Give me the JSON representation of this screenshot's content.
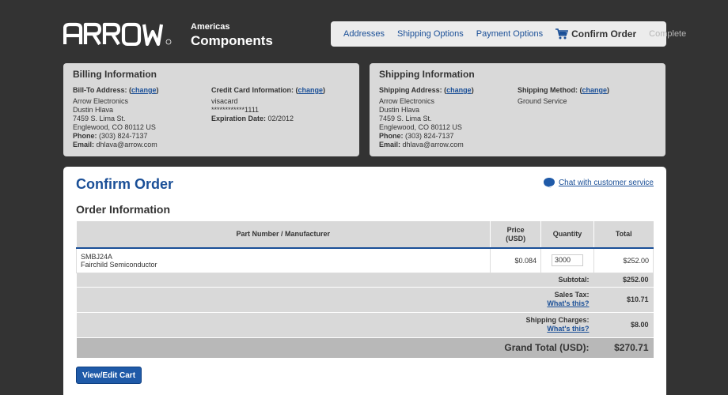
{
  "brand": {
    "logo_text": "ARROW",
    "region": "Americas",
    "name": "Components"
  },
  "steps": {
    "addresses": "Addresses",
    "shipping_options": "Shipping Options",
    "payment_options": "Payment Options",
    "confirm_order": "Confirm Order",
    "complete": "Complete"
  },
  "billing": {
    "title": "Billing Information",
    "bill_to_label": "Bill-To Address:",
    "change": "change",
    "address": [
      "Arrow Electronics",
      "Dustin Hlava",
      "7459 S. Lima St.",
      "Englewood, CO 80112 US"
    ],
    "phone_label": "Phone:",
    "phone": "(303) 824-7137",
    "email_label": "Email:",
    "email": "dhlava@arrow.com",
    "card_label": "Credit Card Information:",
    "card_type": "visacard",
    "card_number": "************1111",
    "exp_label": "Expiration Date:",
    "exp_value": "02/2012"
  },
  "shipping": {
    "title": "Shipping Information",
    "ship_to_label": "Shipping Address:",
    "change": "change",
    "address": [
      "Arrow Electronics",
      "Dustin Hlava",
      "7459 S. Lima St.",
      "Englewood, CO 80112 US"
    ],
    "phone_label": "Phone:",
    "phone": "(303) 824-7137",
    "email_label": "Email:",
    "email": "dhlava@arrow.com",
    "method_label": "Shipping Method:",
    "method": "Ground Service"
  },
  "main": {
    "title": "Confirm Order",
    "chat": "Chat with customer service",
    "order_title": "Order Information",
    "columns": {
      "part": "Part Number / Manufacturer",
      "price_1": "Price",
      "price_2": "(USD)",
      "quantity": "Quantity",
      "total": "Total"
    },
    "rows": [
      {
        "part": "SMBJ24A",
        "manufacturer": "Fairchild Semiconductor",
        "price": "$0.084",
        "quantity": "3000",
        "total": "$252.00"
      }
    ],
    "subtotal_label": "Subtotal:",
    "subtotal": "$252.00",
    "tax_label": "Sales Tax:",
    "tax": "$10.71",
    "whats_this": "What's this?",
    "shipping_label": "Shipping Charges:",
    "shipping_charge": "$8.00",
    "grand_label": "Grand Total (USD):",
    "grand_total": "$270.71",
    "cart_button": "View/Edit Cart"
  }
}
